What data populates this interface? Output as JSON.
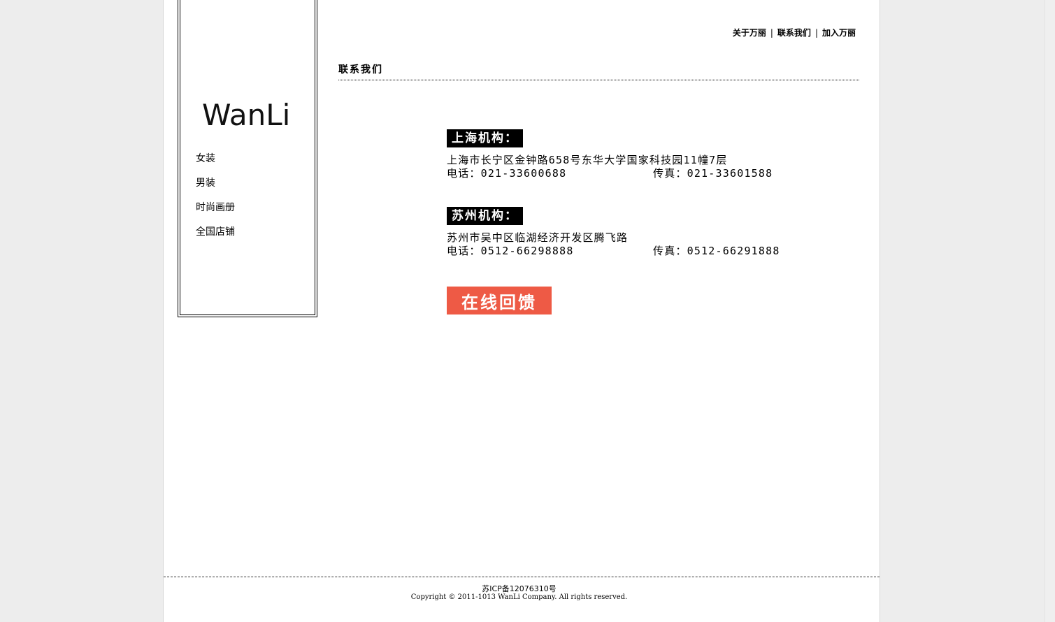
{
  "brand": {
    "logo_text": "WanLi"
  },
  "sidebar": {
    "items": [
      {
        "label": "女装"
      },
      {
        "label": "男装"
      },
      {
        "label": "时尚画册"
      },
      {
        "label": "全国店铺"
      }
    ]
  },
  "top_links": {
    "about": "关于万丽",
    "contact": "联系我们",
    "join": "加入万丽",
    "separator": "|"
  },
  "main": {
    "title": "联系我们",
    "offices": [
      {
        "label": "上海机构：",
        "address": "上海市长宁区金钟路658号东华大学国家科技园11幢7层",
        "phone": "电话：021-33600688",
        "fax": "传真：021-33601588"
      },
      {
        "label": "苏州机构：",
        "address": "苏州市吴中区临湖经济开发区腾飞路",
        "phone": "电话：0512-66298888",
        "fax": "传真：0512-66291888"
      }
    ],
    "feedback_label": "在线回馈"
  },
  "footer": {
    "icp": "苏ICP备12076310号",
    "copyright": "Copyright © 2011-1013 WanLi Company. All rights reserved."
  },
  "colors": {
    "feedback_bg": "#ee5a45",
    "page_bg": "#ededed",
    "label_bg": "#000000"
  }
}
